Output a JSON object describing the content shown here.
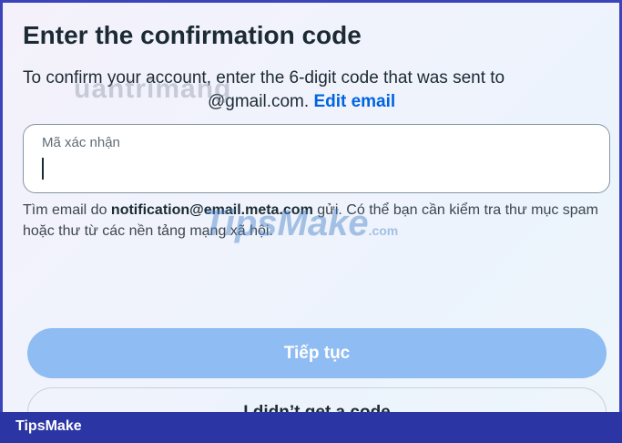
{
  "page": {
    "title": "Enter the confirmation code",
    "subtitle_prefix": "To confirm your account, enter the 6-digit code that was sent to",
    "subtitle_email": "@gmail.com.",
    "edit_email_link": "Edit email"
  },
  "code_input": {
    "label": "Mã xác nhận",
    "value": ""
  },
  "hint": {
    "prefix": "Tìm email do ",
    "sender": "notification@email.meta.com",
    "suffix": " gửi. Có thể bạn cần kiểm tra thư mục spam hoặc thư từ các nền tảng mạng xã hội."
  },
  "buttons": {
    "continue_label": "Tiếp tục",
    "no_code_label": "I didn’t get a code"
  },
  "watermarks": {
    "top": "uantrimang",
    "middle": "TipsMake",
    "middle_suffix": ".com"
  },
  "footer": {
    "brand": "TipsMake"
  },
  "colors": {
    "primary_button": "#8fbcf2",
    "link": "#0064e0",
    "footer_bar": "#2c35a4"
  }
}
